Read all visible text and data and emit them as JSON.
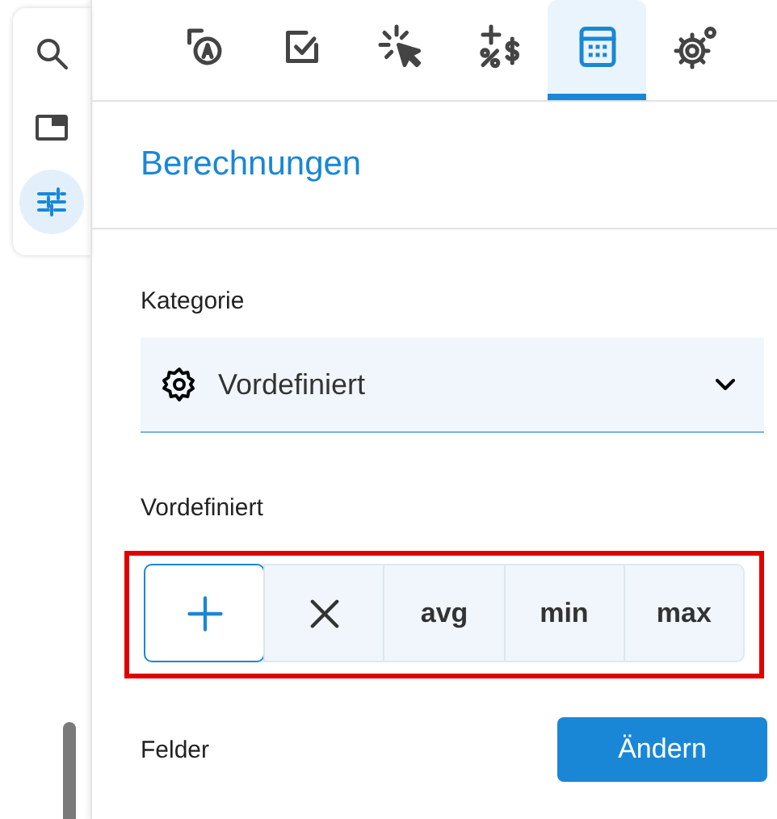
{
  "rail": {
    "items": [
      {
        "kind": "search",
        "selected": false
      },
      {
        "kind": "window",
        "selected": false
      },
      {
        "kind": "sliders",
        "selected": true
      }
    ]
  },
  "tabs": [
    {
      "kind": "text-style",
      "selected": false
    },
    {
      "kind": "checkbox",
      "selected": false
    },
    {
      "kind": "click",
      "selected": false
    },
    {
      "kind": "math",
      "selected": false
    },
    {
      "kind": "calculator",
      "selected": true
    },
    {
      "kind": "gears",
      "selected": false
    }
  ],
  "panel": {
    "title": "Berechnungen",
    "category": {
      "label": "Kategorie",
      "value": "Vordefiniert"
    },
    "predefined": {
      "label": "Vordefiniert",
      "highlighted": true,
      "options": [
        {
          "kind": "plus",
          "selected": true
        },
        {
          "kind": "cross",
          "selected": false
        },
        {
          "kind": "text",
          "label": "avg",
          "selected": false
        },
        {
          "kind": "text",
          "label": "min",
          "selected": false
        },
        {
          "kind": "text",
          "label": "max",
          "selected": false
        }
      ]
    },
    "fields": {
      "label": "Felder",
      "button": "Ändern"
    }
  }
}
